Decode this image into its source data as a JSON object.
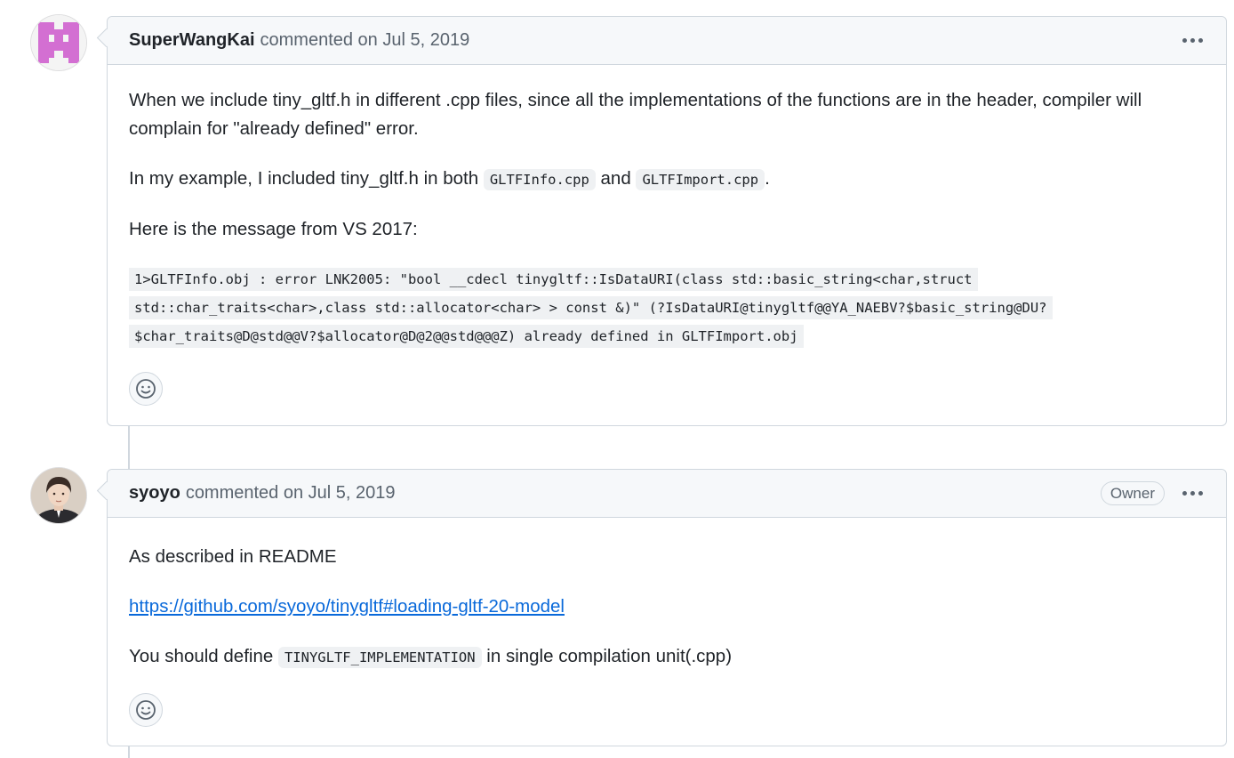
{
  "comments": [
    {
      "author": "SuperWangKai",
      "meta": "commented on Jul 5, 2019",
      "badge": "",
      "avatar_color": "#d36fd2",
      "paragraphs": {
        "p1": "When we include tiny_gltf.h in different .cpp files, since all the implementations of the functions are in the header, compiler will complain for \"already defined\" error.",
        "p2_before": "In my example, I included tiny_gltf.h in both ",
        "p2_code1": "GLTFInfo.cpp",
        "p2_mid": " and ",
        "p2_code2": "GLTFImport.cpp",
        "p2_after": ".",
        "p3": "Here is the message from VS 2017:",
        "code_block": "1>GLTFInfo.obj : error LNK2005: \"bool __cdecl tinygltf::IsDataURI(class std::basic_string<char,struct std::char_traits<char>,class std::allocator<char> > const &)\" (?IsDataURI@tinygltf@@YA_NAEBV?$basic_string@DU?$char_traits@D@std@@V?$allocator@D@2@@std@@@Z) already defined in GLTFImport.obj"
      },
      "reaction_icon": "smiley-icon"
    },
    {
      "author": "syoyo",
      "meta": "commented on Jul 5, 2019",
      "badge": "Owner",
      "avatar_color": "#8a7a6c",
      "paragraphs": {
        "p1": "As described in README",
        "link": "https://github.com/syoyo/tinygltf#loading-gltf-20-model",
        "p3_before": "You should define ",
        "p3_code": "TINYGLTF_IMPLEMENTATION",
        "p3_after": " in single compilation unit(.cpp)"
      },
      "reaction_icon": "smiley-icon"
    }
  ],
  "colors": {
    "border": "#d0d7de",
    "header_bg": "#f6f8fa",
    "link": "#0969da",
    "muted": "#59636e"
  }
}
